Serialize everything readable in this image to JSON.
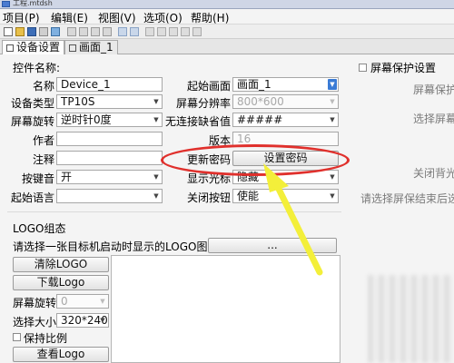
{
  "window": {
    "title": "工程.mtdsh"
  },
  "menu": [
    "项目(P)",
    "编辑(E)",
    "视图(V)",
    "选项(O)",
    "帮助(H)"
  ],
  "tabs": [
    {
      "label": "设备设置",
      "active": true
    },
    {
      "label": "画面_1",
      "active": false
    }
  ],
  "panel": {
    "section_title": "控件名称:",
    "left": {
      "name_label": "名称",
      "name_value": "Device_1",
      "device_type_label": "设备类型",
      "device_type_value": "TP10S",
      "screen_rotation_label": "屏幕旋转",
      "screen_rotation_value": "逆时针0度",
      "author_label": "作者",
      "author_value": "",
      "note_label": "注释",
      "note_value": "",
      "key_sound_label": "按键音",
      "key_sound_value": "开",
      "start_language_label": "起始语言",
      "start_language_value": ""
    },
    "right": {
      "start_screen_label": "起始画面",
      "start_screen_value": "画面_1",
      "resolution_label": "屏幕分辨率",
      "resolution_value": "800*600",
      "no_connection_label": "无连接缺省值",
      "no_connection_value": "#####",
      "version_label": "版本",
      "version_value": "16",
      "update_password_label": "更新密码",
      "set_password_button": "设置密码",
      "display_cursor_label": "显示光标",
      "display_cursor_value": "隐藏",
      "close_button_label": "关闭按钮",
      "close_button_value": "使能"
    },
    "screensaver": {
      "checkbox_label": "屏幕保护设置",
      "screensaver_partial": "屏幕保护",
      "select_screen_partial": "选择屏幕",
      "close_backlight_partial": "关闭背光",
      "select_after_partial": "请选择屏保结束后选"
    },
    "logo": {
      "title": "LOGO组态",
      "prompt": "请选择一张目标机启动时显示的LOGO图片",
      "browse_button": "...",
      "clear_button": "清除LOGO",
      "download_button": "下载Logo",
      "rotation_label": "屏幕旋转",
      "rotation_value": "0",
      "size_label": "选择大小",
      "size_value": "320*240",
      "keep_ratio_label": "保持比例",
      "view_button": "查看Logo"
    }
  }
}
